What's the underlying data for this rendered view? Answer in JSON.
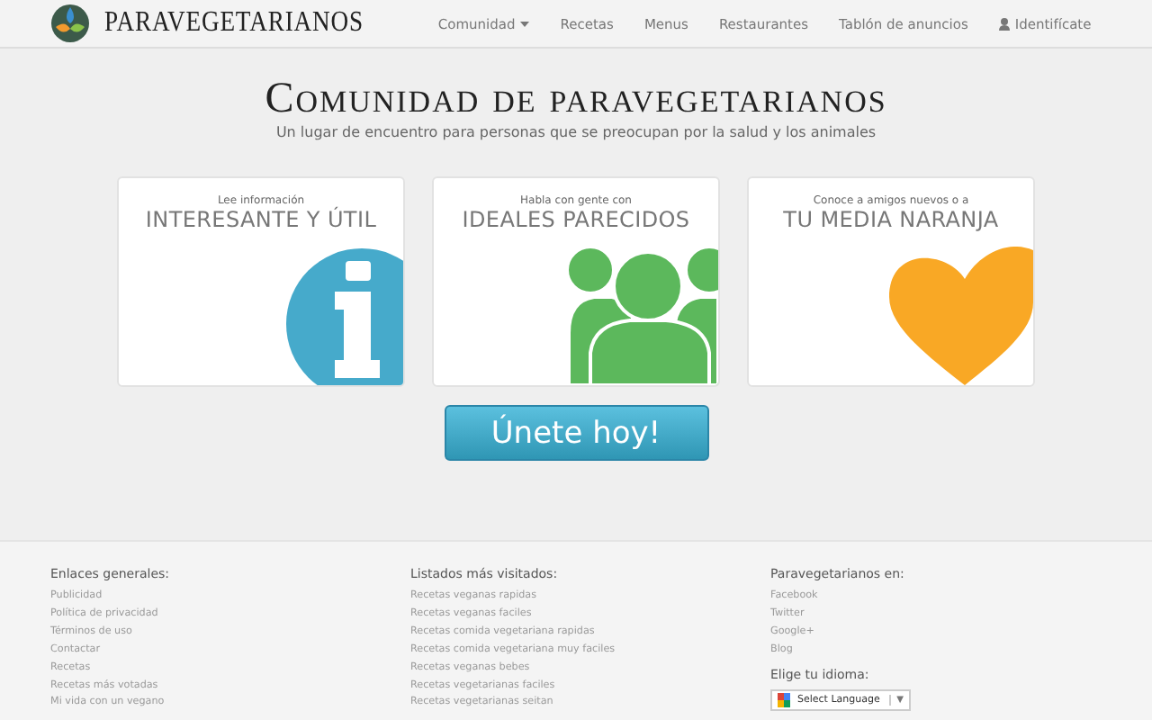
{
  "header": {
    "logo_text": "PARAVEGETARIANOS",
    "nav": [
      {
        "label": "Comunidad",
        "kind": "dropdown"
      },
      {
        "label": "Recetas",
        "kind": "link"
      },
      {
        "label": "Menus",
        "kind": "link"
      },
      {
        "label": "Restaurantes",
        "kind": "link"
      },
      {
        "label": "Tablón de anuncios",
        "kind": "link"
      },
      {
        "label": "Identifícate",
        "kind": "user"
      }
    ]
  },
  "hero": {
    "title": "Comunidad de paravegetarianos",
    "subtitle": "Un lugar de encuentro para personas que se preocupan por la salud y los animales"
  },
  "cards": [
    {
      "kicker": "Lee información",
      "headline": "INTERESANTE Y ÚTIL",
      "kind": "info"
    },
    {
      "kicker": "Habla con gente con",
      "headline": "IDEALES PARECIDOS",
      "kind": "people"
    },
    {
      "kicker": "Conoce a amigos nuevos o a",
      "headline": "TU MEDIA NARANJA",
      "kind": "heart"
    }
  ],
  "join_button": "Únete hoy!",
  "footer": {
    "columns": [
      {
        "heading": "Enlaces generales:",
        "links": [
          "Publicidad",
          "Política de privacidad",
          "Términos de uso",
          "Contactar",
          "Recetas",
          "Recetas más votadas",
          "Mi vida con un vegano"
        ]
      },
      {
        "heading": "Listados más visitados:",
        "links": [
          "Recetas veganas rapidas",
          "Recetas veganas faciles",
          "Recetas comida vegetariana rapidas",
          "Recetas comida vegetariana muy faciles",
          "Recetas veganas bebes",
          "Recetas vegetarianas faciles",
          "Recetas vegetarianas seitan"
        ]
      },
      {
        "heading": "Paravegetarianos en:",
        "links": [
          "Facebook",
          "Twitter",
          "Google+",
          "Blog"
        ],
        "language_label": "Elige tu idioma:",
        "language_select": "Select Language",
        "select_arrow": "▼"
      }
    ]
  }
}
